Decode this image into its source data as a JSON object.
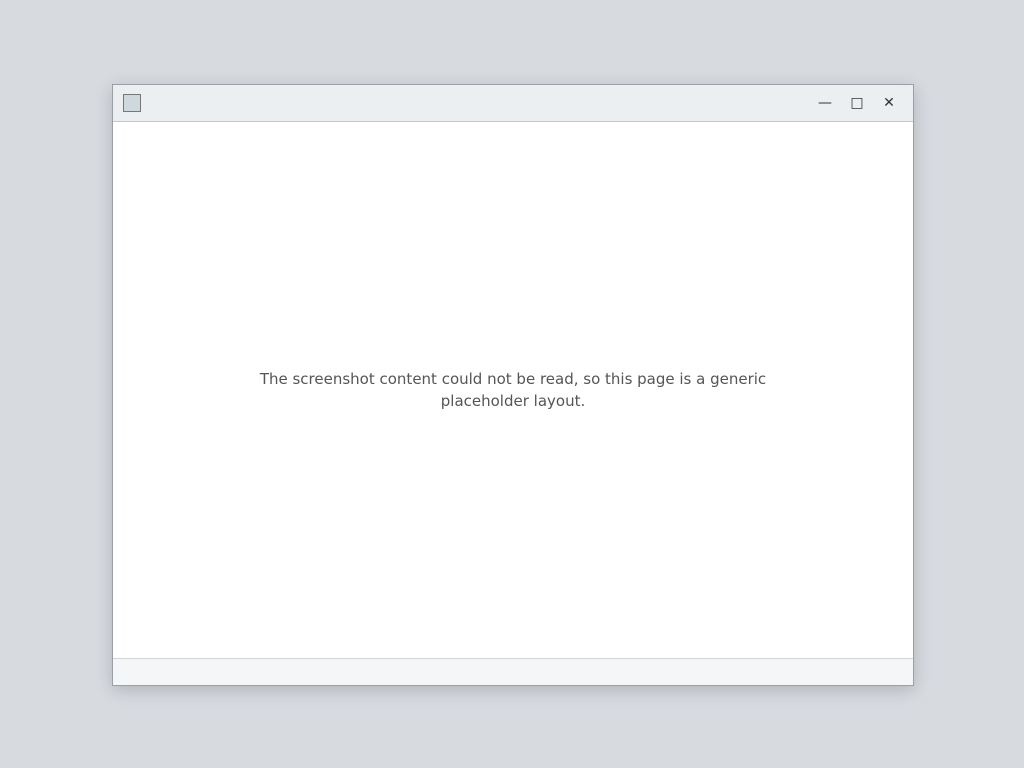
{
  "window": {
    "title": ""
  },
  "controls": {
    "minimize": "—",
    "maximize": "□",
    "close": "✕"
  },
  "content": {
    "message": "The screenshot content could not be read, so this page is a generic placeholder layout."
  },
  "statusbar": {
    "text": ""
  }
}
